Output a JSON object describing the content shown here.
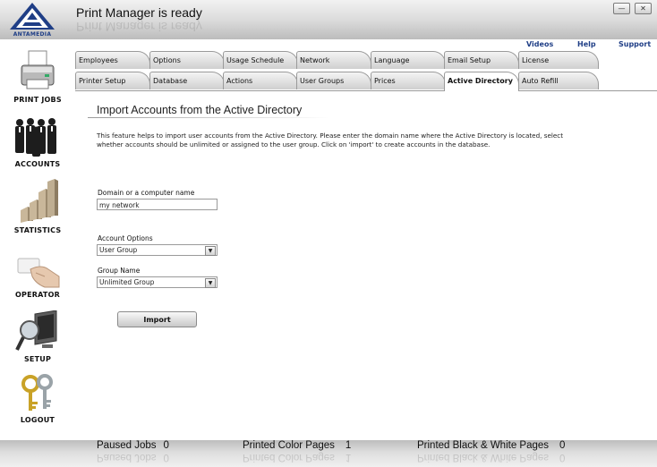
{
  "header": {
    "brand": "ANTAMEDIA",
    "title": "Print Manager is ready",
    "window_buttons": [
      "minimize",
      "close"
    ]
  },
  "top_links": {
    "videos": "Videos",
    "help": "Help",
    "support": "Support"
  },
  "sidebar": {
    "items": [
      {
        "label": "PRINT JOBS",
        "icon": "printer-icon"
      },
      {
        "label": "ACCOUNTS",
        "icon": "people-icon"
      },
      {
        "label": "STATISTICS",
        "icon": "statistics-icon"
      },
      {
        "label": "OPERATOR",
        "icon": "hand-card-icon"
      },
      {
        "label": "SETUP",
        "icon": "monitor-magnifier-icon"
      },
      {
        "label": "LOGOUT",
        "icon": "keys-icon"
      }
    ]
  },
  "tabs": {
    "row1": [
      "Employees",
      "Options",
      "Usage Schedule",
      "Network",
      "Language",
      "Email Setup",
      "License"
    ],
    "row2": [
      "Printer Setup",
      "Database",
      "Actions",
      "User Groups",
      "Prices",
      "Active Directory",
      "Auto Refill"
    ],
    "active": "Active Directory"
  },
  "content": {
    "title": "Import Accounts from the Active Directory",
    "description": "This feature helps to import user accounts from the Active Directory. Please enter the domain name where the Active Directory is located, select whether accounts should be unlimited or assigned to the user group. Click on 'import'  to create accounts in the database.",
    "domain": {
      "label": "Domain or a computer name",
      "value": "my network"
    },
    "account_options": {
      "label": "Account Options",
      "value": "User Group"
    },
    "group_name": {
      "label": "Group Name",
      "value": "Unlimited Group"
    },
    "import_label": "Import"
  },
  "footer": {
    "paused_jobs": {
      "label": "Paused Jobs",
      "value": "0"
    },
    "printed_color": {
      "label": "Printed Color Pages",
      "value": "1"
    },
    "printed_bw": {
      "label": "Printed Black & White Pages",
      "value": "0"
    }
  },
  "colors": {
    "link": "#1f3e86",
    "brand": "#1f3e86"
  }
}
